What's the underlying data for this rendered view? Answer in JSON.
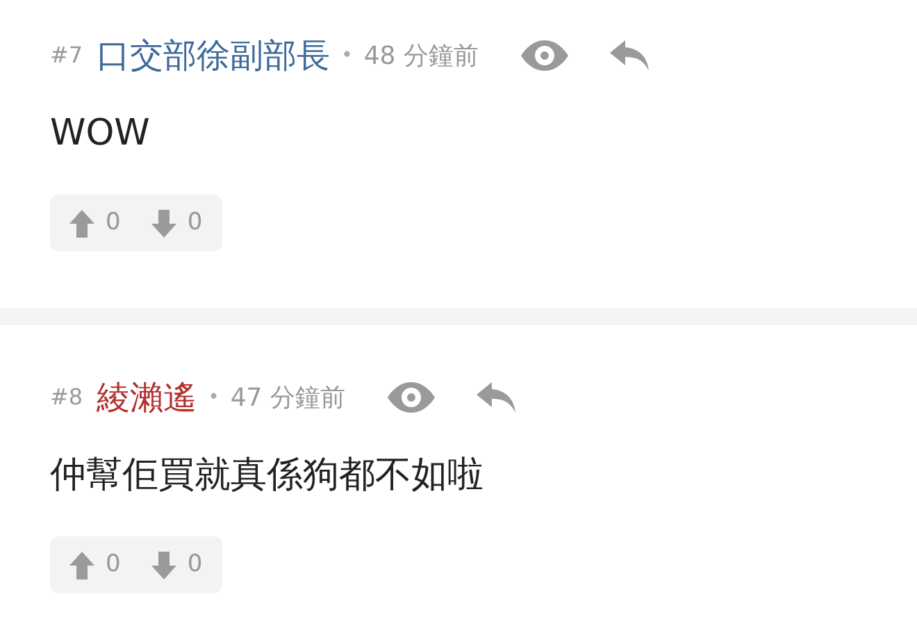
{
  "comments": [
    {
      "floor": "#7",
      "username": "口交部徐副部長",
      "color": "#3d6a9a",
      "separator": "•",
      "time": "48 分鐘前",
      "body": "WOW",
      "upvotes": "0",
      "downvotes": "0"
    },
    {
      "floor": "#8",
      "username": "綾瀨遙",
      "color": "#b3302f",
      "separator": "•",
      "time": "47 分鐘前",
      "body": "仲幫佢買就真係狗都不如啦",
      "upvotes": "0",
      "downvotes": "0"
    }
  ]
}
